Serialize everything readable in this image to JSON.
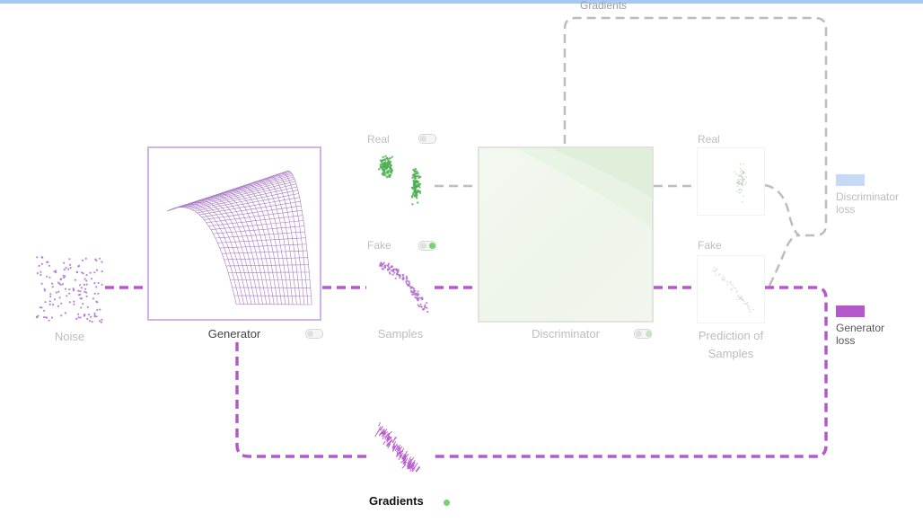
{
  "header": {
    "gradients_label": "Gradients"
  },
  "nodes": {
    "noise": {
      "label": "Noise"
    },
    "generator": {
      "label": "Generator"
    },
    "real": {
      "label": "Real"
    },
    "fake": {
      "label": "Fake"
    },
    "samples": {
      "label": "Samples"
    },
    "discriminator": {
      "label": "Discriminator"
    },
    "pred_real": {
      "label": "Real"
    },
    "pred_fake": {
      "label": "Fake"
    },
    "prediction": {
      "line1": "Prediction of",
      "line2": "Samples"
    },
    "gradients": {
      "label": "Gradients"
    }
  },
  "legend": {
    "discriminator_loss": {
      "line1": "Discriminator",
      "line2": "loss",
      "color": "#c6d9f5"
    },
    "generator_loss": {
      "line1": "Generator",
      "line2": "loss",
      "color": "#b558cc"
    }
  },
  "colors": {
    "purple": "#b558cc",
    "gray": "#b0b0b0",
    "green": "#7ccf72",
    "noise_points": "#b070d0",
    "real_points": "#4caf50"
  }
}
